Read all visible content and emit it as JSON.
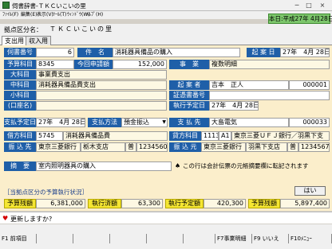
{
  "window": {
    "title": "伺書辞書-ＴＫＣいこいの里",
    "btn_min": "─",
    "btn_max": "□",
    "btn_close": "×"
  },
  "menu": [
    "ﾌｧｲﾙ(F)",
    "編集(E)",
    "表示(V)",
    "ﾂｰﾙ(T)",
    "ｳｨﾝﾄﾞｳ(W)",
    "ﾍﾙﾌﾟ(H)"
  ],
  "date_display": "本日:平成27年 4月28日(火)",
  "business": {
    "label": "拠点区分名：",
    "value": "ＴＫＣいこいの里"
  },
  "tabs": [
    {
      "label": "支出用",
      "active": true
    },
    {
      "label": "収入用",
      "active": false
    }
  ],
  "form": {
    "ukagai_no": {
      "label": "伺書番号",
      "value": "6"
    },
    "kenmei": {
      "label": "件　名",
      "value": "消耗器具備品の購入"
    },
    "kian_date": {
      "label": "起 案 日",
      "value": "27年　4月 28日"
    },
    "budget_subject": {
      "label": "予算科目",
      "code": "8345"
    },
    "current_request": {
      "label": "今回申請額",
      "value": "152,000"
    },
    "jigyo": {
      "label": "事　業",
      "value": "複数明細"
    },
    "daikamoku": {
      "label": "大科目",
      "value": "事業費支出"
    },
    "chukamoku": {
      "label": "中科目",
      "value": "消耗器具備品費支出"
    },
    "shokamoku": {
      "label": "小科目",
      "value": ""
    },
    "kuchi": {
      "label": "(口座名)",
      "value": ""
    },
    "kiansha": {
      "label": "起 案 者",
      "name": "吉本　正人",
      "code": "000001"
    },
    "evidence_no": {
      "label": "証憑書番号",
      "value": ""
    },
    "exec_date": {
      "label": "執行予定日",
      "value": "27年　4月 28日"
    },
    "pay_date": {
      "label": "支払予定日",
      "value": "27年　4月 28日"
    },
    "pay_method": {
      "label": "支払方法",
      "value": "預金振込",
      "dropdown_icon": "chevron-down"
    },
    "payee": {
      "label": "支 払 先",
      "name": "大島電気",
      "code": "000033"
    },
    "debit": {
      "label": "借方科目",
      "code": "5745",
      "name": "消耗器具備品費"
    },
    "credit": {
      "label": "貸方科目",
      "code": "1113",
      "sub": "A1",
      "name": "東京三菱ＵＦＪ銀行／羽黒下支"
    },
    "transfer_to": {
      "label": "振 込 先",
      "bank": "東京三菱銀行",
      "branch": "栃木支店",
      "type": "普",
      "account": "1234560"
    },
    "transfer_from": {
      "label": "振 込 元",
      "bank": "東京三菱銀行",
      "branch": "羽黒下支店",
      "type": "普",
      "account": "1234567"
    },
    "tekiyo": {
      "label": "摘　要",
      "value": "室内照明器具の購入",
      "note_icon": "spade-icon",
      "note": "この行は会計伝票の元帳摘要欄に転記されます"
    }
  },
  "budget_status": {
    "section_label": "［当拠点区分の予算執行状況］",
    "hai_button": "はい",
    "zandaka_label": "予算残額",
    "zandaka": "6,381,000",
    "shikko_label": "執行済額",
    "shikko": "63,300",
    "yotei_label": "執行予定額",
    "yotei": "420,300",
    "zan_label": "予算残額",
    "zan": "5,897,400"
  },
  "message": {
    "icon": "heart-icon",
    "text": "更新しますか?"
  },
  "fkeys": [
    "F1 前項目",
    "",
    "",
    "",
    "",
    "",
    "F7事業明細",
    "F9 いいえ",
    "F10ﾒﾆｭｰ"
  ]
}
